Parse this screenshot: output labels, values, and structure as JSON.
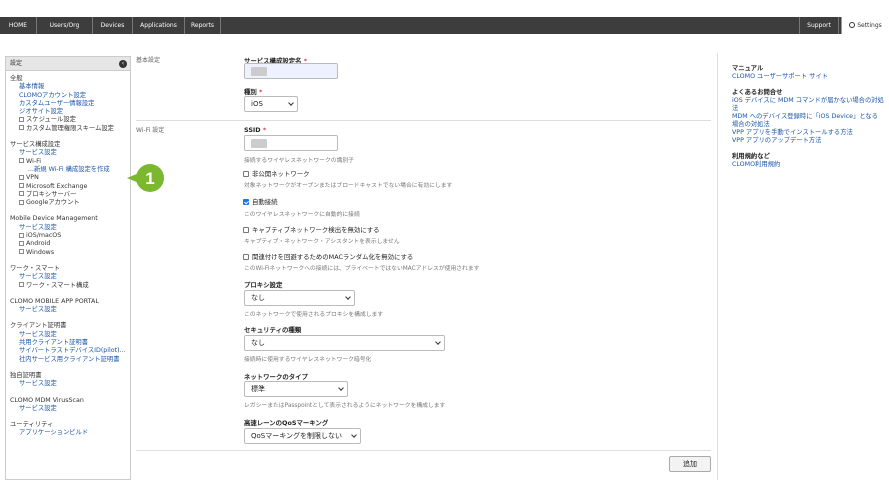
{
  "nav": {
    "tabs": [
      "HOME",
      "Users/Org",
      "Devices",
      "Applications",
      "Reports"
    ],
    "support": "Support",
    "settings": "Settings"
  },
  "sidebar": {
    "header": "設定",
    "sections": [
      {
        "title": "全般",
        "items": [
          {
            "t": "link",
            "label": "基本情報"
          },
          {
            "t": "link",
            "label": "CLOMOアカウント設定"
          },
          {
            "t": "link",
            "label": "カスタムユーザー情報設定"
          },
          {
            "t": "link",
            "label": "ジオサイト設定"
          },
          {
            "t": "tree",
            "label": "スケジュール設定"
          },
          {
            "t": "tree",
            "label": "カスタム管理権限スキーム設定"
          }
        ]
      },
      {
        "title": "サービス構成設定",
        "items": [
          {
            "t": "link",
            "label": "サービス設定"
          },
          {
            "t": "tree",
            "label": "Wi-Fi"
          },
          {
            "t": "sub",
            "label": "...新規 Wi-Fi 構成設定を作成"
          },
          {
            "t": "tree",
            "label": "VPN"
          },
          {
            "t": "tree",
            "label": "Microsoft Exchange"
          },
          {
            "t": "tree",
            "label": "プロキシサーバー"
          },
          {
            "t": "tree",
            "label": "Googleアカウント"
          }
        ]
      },
      {
        "title": "Mobile Device Management",
        "items": [
          {
            "t": "link",
            "label": "サービス設定"
          },
          {
            "t": "tree",
            "label": "iOS/macOS"
          },
          {
            "t": "tree",
            "label": "Android"
          },
          {
            "t": "tree",
            "label": "Windows"
          }
        ]
      },
      {
        "title": "ワーク・スマート",
        "items": [
          {
            "t": "link",
            "label": "サービス設定"
          },
          {
            "t": "tree",
            "label": "ワーク・スマート構成"
          }
        ]
      },
      {
        "title": "CLOMO MOBILE APP PORTAL",
        "items": [
          {
            "t": "link",
            "label": "サービス設定"
          }
        ]
      },
      {
        "title": "クライアント証明書",
        "items": [
          {
            "t": "link",
            "label": "サービス設定"
          },
          {
            "t": "link",
            "label": "共用クライアント証明書"
          },
          {
            "t": "link",
            "label": "サイバートラストデバイスID(pilot)..."
          },
          {
            "t": "link",
            "label": "社内サービス用クライアント証明書"
          }
        ]
      },
      {
        "title": "独自証明書",
        "items": [
          {
            "t": "link",
            "label": "サービス設定"
          }
        ]
      },
      {
        "title": "CLOMO MDM VirusScan",
        "items": [
          {
            "t": "link",
            "label": "サービス設定"
          }
        ]
      },
      {
        "title": "ユーティリティ",
        "items": [
          {
            "t": "link",
            "label": "アプリケーションビルド"
          }
        ]
      }
    ]
  },
  "badge": {
    "number": "1",
    "color": "#7cb82f"
  },
  "form": {
    "basic_section": "基本設定",
    "service_name_label": "サービス構成設定名",
    "required_mark": "*",
    "type_label": "種別",
    "type_value": "iOS",
    "wifi_section": "Wi-Fi 設定",
    "ssid_label": "SSID",
    "ssid_help": "接続するワイヤレスネットワークの識別子",
    "hidden_label": "非公開ネットワーク",
    "hidden_help": "対象ネットワークがオープンまたはブロードキャストでない場合に有効にします",
    "auto_label": "自動接続",
    "auto_help": "このワイヤレスネットワークに自動的に接続",
    "captive_label": "キャプティブネットワーク検出を無効にする",
    "captive_help": "キャプティブ・ネットワーク・アシスタントを表示しません",
    "mac_label": "関連付けを回避するためのMACランダム化を無効にする",
    "mac_help": "このWi-Fiネットワークへの接続には、プライベートではないMACアドレスが使用されます",
    "proxy_label": "プロキシ設定",
    "proxy_value": "なし",
    "proxy_help": "このネットワークで使用されるプロキシを構成します",
    "security_label": "セキュリティの種類",
    "security_value": "なし",
    "security_help": "接続時に使用するワイヤレスネットワーク暗号化",
    "nettype_label": "ネットワークのタイプ",
    "nettype_value": "標準",
    "nettype_help": "レガシーまたはPasspointとして表示されるようにネットワークを構成します",
    "qos_label": "高速レーンのQoSマーキング",
    "qos_value": "QoSマーキングを制限しない",
    "add_button": "追加"
  },
  "right_panel": {
    "manual_title": "マニュアル",
    "manual_link": "CLOMO ユーザーサポート サイト",
    "faq_title": "よくあるお問合せ",
    "faq_links": [
      "iOS デバイスに MDM コマンドが届かない場合の対処法",
      "MDM へのデバイス登録時に「iOS Device」となる場合の対処法",
      "VPP アプリを手動でインストールする方法",
      "VPP アプリのアップデート方法"
    ],
    "terms_title": "利用規約など",
    "terms_link": "CLOMO利用規約"
  }
}
